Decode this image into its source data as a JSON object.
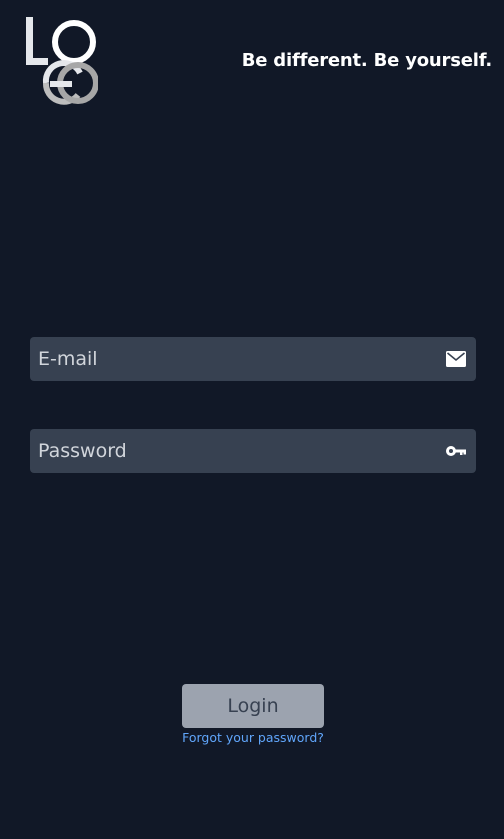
{
  "header": {
    "logo_text": "LOGO",
    "tagline": "Be different. Be yourself."
  },
  "form": {
    "email": {
      "placeholder": "E-mail",
      "value": "",
      "icon": "envelope-icon"
    },
    "password": {
      "placeholder": "Password",
      "value": "",
      "icon": "key-icon"
    },
    "login_label": "Login",
    "forgot_label": "Forgot your password?"
  },
  "colors": {
    "background": "#111827",
    "field": "#374151",
    "button": "#9ca3af",
    "link": "#60a5fa",
    "logo": "#e5e7eb"
  }
}
